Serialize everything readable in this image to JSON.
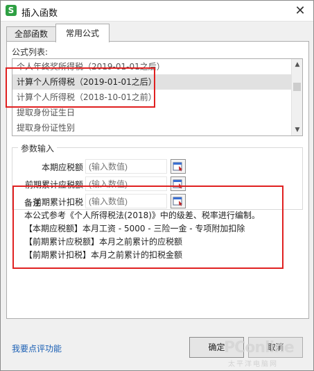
{
  "window": {
    "app_icon_letter": "S",
    "title": "插入函数",
    "close_glyph": "✕"
  },
  "tabs": [
    {
      "label": "全部函数",
      "active": false
    },
    {
      "label": "常用公式",
      "active": true
    }
  ],
  "formula_list": {
    "label": "公式列表:",
    "items": [
      {
        "label": "个人年终奖所得税（2019-01-01之后）",
        "selected": false
      },
      {
        "label": "计算个人所得税（2019-01-01之后）",
        "selected": true
      },
      {
        "label": "计算个人所得税（2018-10-01之前）",
        "selected": false
      },
      {
        "label": "提取身份证生日",
        "selected": false
      },
      {
        "label": "提取身份证性别",
        "selected": false
      }
    ],
    "scroll_up_glyph": "▲",
    "scroll_down_glyph": "▼"
  },
  "params": {
    "title": "参数输入",
    "rows": [
      {
        "label": "本期应税额",
        "placeholder": "(输入数值)",
        "picker_icon": "cell-reference-icon"
      },
      {
        "label": "前期累计应税额",
        "placeholder": "(输入数值)",
        "picker_icon": "cell-reference-icon"
      },
      {
        "label": "前期累计扣税",
        "placeholder": "(输入数值)",
        "picker_icon": "cell-reference-icon"
      }
    ]
  },
  "note": {
    "title": "备注",
    "lines": [
      "本公式参考《个人所得税法(2018)》中的级差、税率进行编制。",
      "【本期应税额】本月工资 - 5000 - 三险一金 - 专项附加扣除",
      "【前期累计应税额】本月之前累计的应税额",
      "【前期累计扣税】本月之前累计的扣税金额"
    ]
  },
  "footer": {
    "feedback_link": "我要点评功能",
    "ok_label": "确定",
    "cancel_label": "取消"
  },
  "watermark": {
    "main": "PConline",
    "sub": "太平洋电脑网"
  },
  "colors": {
    "highlight_box": "#e02020",
    "link": "#1a5fb4",
    "app_icon": "#2ea043"
  }
}
